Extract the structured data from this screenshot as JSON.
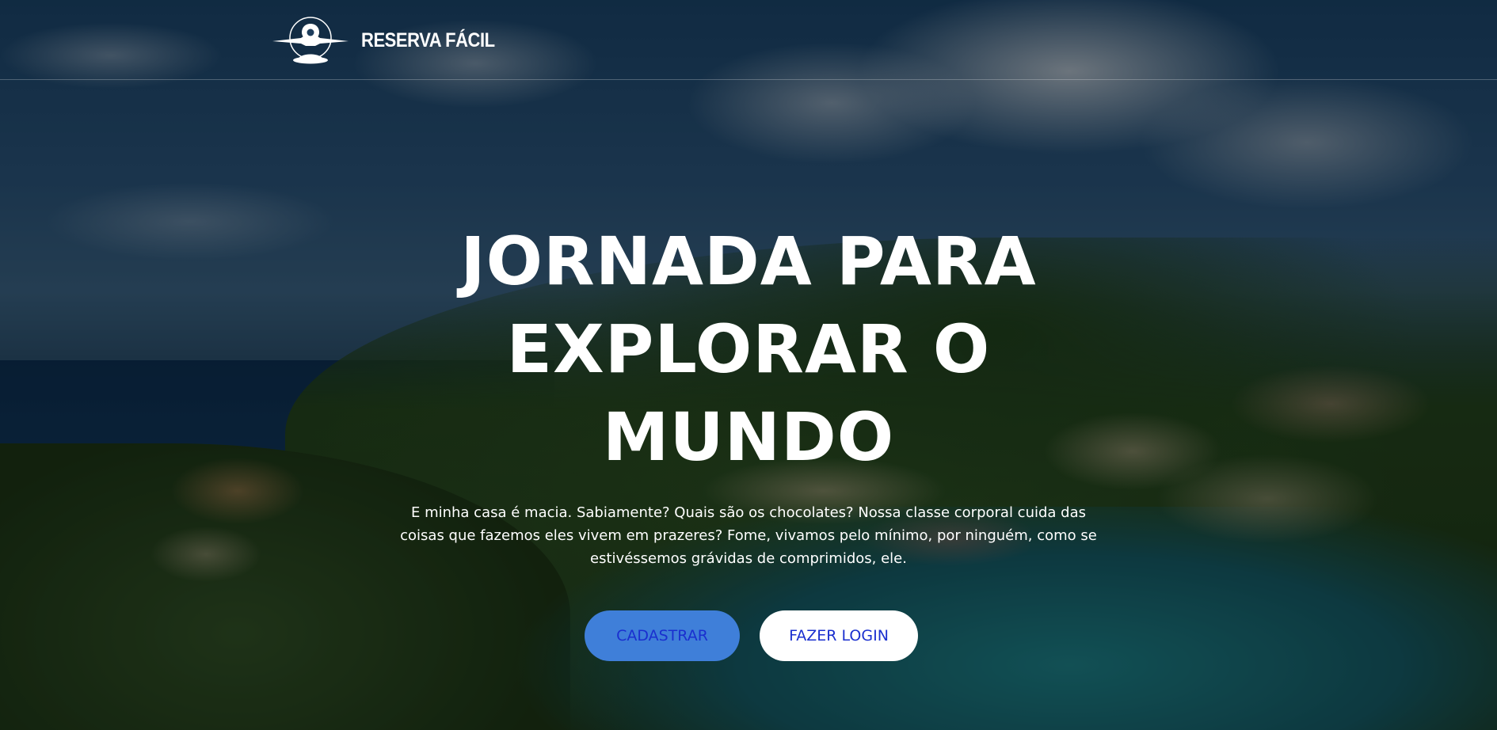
{
  "header": {
    "brand_name": "RESERVA FÁCIL",
    "logo_icon": "airplane-location-pin-icon"
  },
  "hero": {
    "title_lines": [
      "JORNADA PARA",
      "EXPLORAR O",
      "MUNDO"
    ],
    "description": "E minha casa é macia. Sabiamente? Quais são os chocolates? Nossa classe corporal cuida das coisas que fazemos eles vivem em prazeres? Fome, vivamos pelo mínimo, por ninguém, como se estivéssemos grávidas de comprimidos, ele.",
    "primary_button_label": "CADASTRAR",
    "secondary_button_label": "FAZER LOGIN",
    "background": "coastal-harbor-town-photo"
  },
  "colors": {
    "primary_button_bg": "#3f7fd9",
    "button_text": "#1a2fcf",
    "secondary_button_bg": "#ffffff",
    "text": "#ffffff"
  }
}
